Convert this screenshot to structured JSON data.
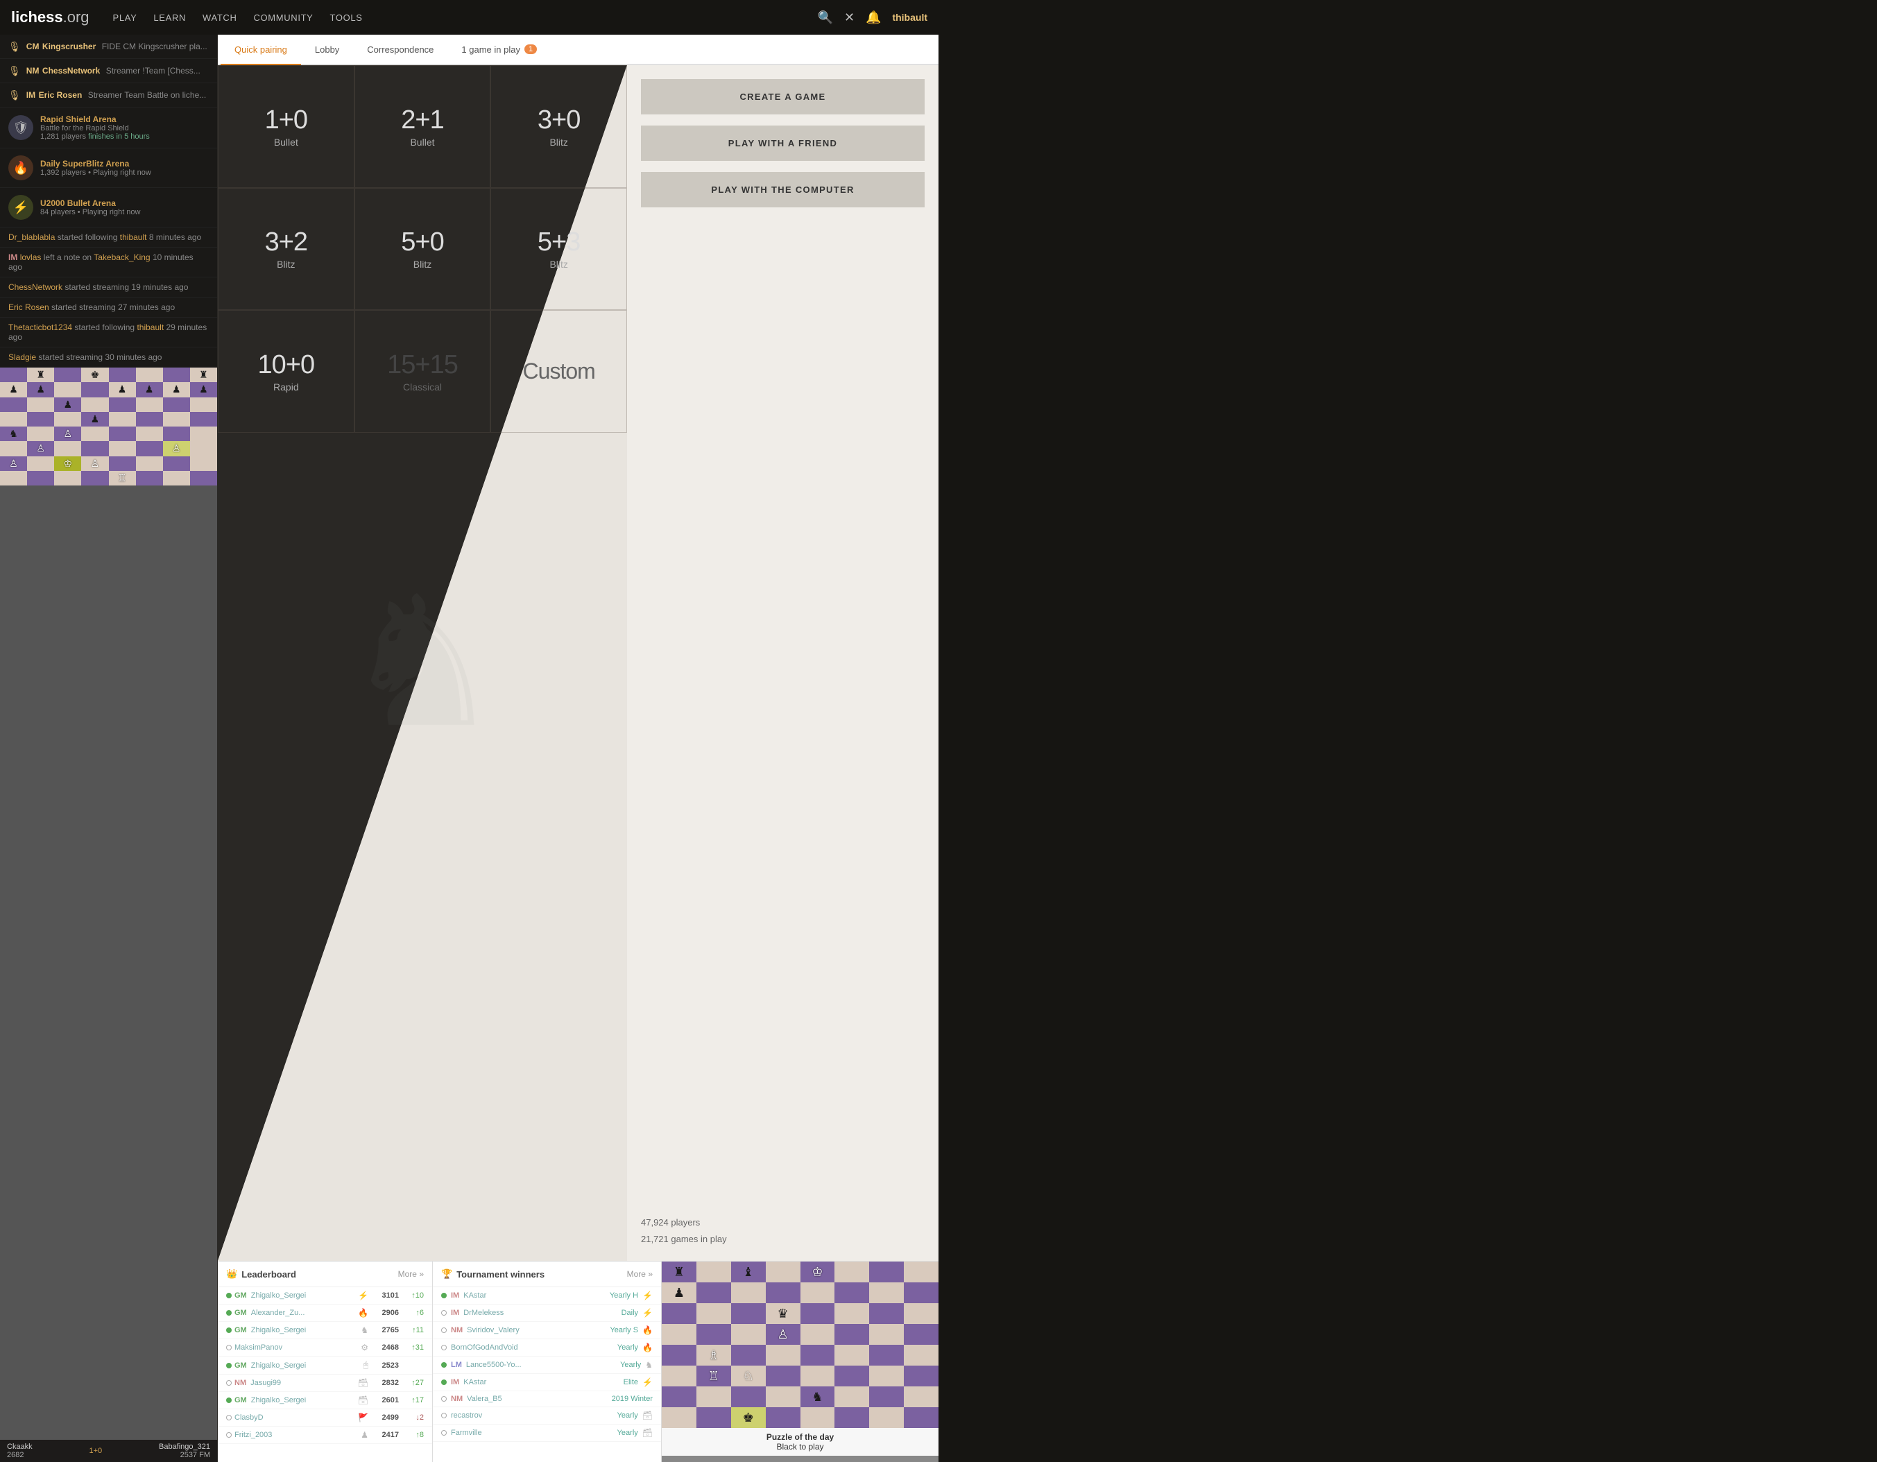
{
  "nav": {
    "logo": "lichess",
    "logo_ext": ".org",
    "links": [
      "PLAY",
      "LEARN",
      "WATCH",
      "COMMUNITY",
      "TOOLS"
    ],
    "user": "thibault"
  },
  "sidebar": {
    "streamers": [
      {
        "title": "CM",
        "name": "Kingscrusher",
        "desc": "FIDE CM Kingscrusher pla..."
      },
      {
        "title": "NM",
        "name": "ChessNetwork",
        "desc": "Streamer !Team [Chess..."
      },
      {
        "title": "IM",
        "name": "Eric Rosen",
        "desc": "Streamer Team Battle on liche..."
      }
    ],
    "tournaments": [
      {
        "icon": "🛡",
        "name": "Rapid Shield Arena",
        "sub": "Battle for the Rapid Shield",
        "players": "1,281 players",
        "time": "finishes in 5 hours"
      },
      {
        "icon": "🔥",
        "name": "Daily SuperBlitz Arena",
        "sub": "1,392 players • Playing right now",
        "players": "",
        "time": ""
      },
      {
        "icon": "⚡",
        "name": "U2000 Bullet Arena",
        "sub": "84 players • Playing right now",
        "players": "",
        "time": ""
      }
    ],
    "activity": [
      {
        "text": "Dr_blablabla started following thibault 8 minutes ago"
      },
      {
        "text": "IM lovlas left a note on Takeback_King 10 minutes ago"
      },
      {
        "text": "ChessNetwork started streaming 19 minutes ago"
      },
      {
        "text": "Eric Rosen started streaming 27 minutes ago"
      },
      {
        "text": "Thetacticbot1234 started following thibault 29 minutes ago"
      },
      {
        "text": "Sladgie started streaming 30 minutes ago"
      }
    ],
    "mini_board": {
      "white_name": "Ckaakk",
      "white_rating": "2682",
      "white_time": "1+0",
      "black_name": "Babafingo_321",
      "black_rating": "2537 FM"
    }
  },
  "tabs": {
    "items": [
      "Quick pairing",
      "Lobby",
      "Correspondence",
      "1 game in play"
    ],
    "active": 0,
    "badge": "1"
  },
  "pairing": {
    "cells": [
      {
        "time": "1+0",
        "type": "Bullet"
      },
      {
        "time": "2+1",
        "type": "Bullet"
      },
      {
        "time": "3+0",
        "type": "Blitz"
      },
      {
        "time": "3+2",
        "type": "Blitz"
      },
      {
        "time": "5+0",
        "type": "Blitz"
      },
      {
        "time": "5+3",
        "type": "Blitz"
      },
      {
        "time": "10+0",
        "type": "Rapid"
      },
      {
        "time": "15+15",
        "type": "Classical"
      },
      {
        "time": "Custom",
        "type": ""
      }
    ]
  },
  "actions": {
    "create": "CREATE A GAME",
    "friend": "PLAY WITH A FRIEND",
    "computer": "PLAY WITH THE COMPUTER",
    "players": "47,924 players",
    "games": "21,721 games in play"
  },
  "leaderboard": {
    "title": "Leaderboard",
    "more": "More »",
    "rows": [
      {
        "online": true,
        "title": "GM",
        "name": "Zhigalko_Sergei",
        "icon": "⚡",
        "rating": "3101",
        "gain": "↑10",
        "gain_neg": false
      },
      {
        "online": true,
        "title": "GM",
        "name": "Alexander_Zu...",
        "icon": "🔥",
        "rating": "2906",
        "gain": "↑6",
        "gain_neg": false
      },
      {
        "online": true,
        "title": "GM",
        "name": "Zhigalko_Sergei",
        "icon": "♞",
        "rating": "2765",
        "gain": "↑11",
        "gain_neg": false
      },
      {
        "online": false,
        "title": "",
        "name": "MaksimPanov",
        "icon": "⚙",
        "rating": "2468",
        "gain": "↑31",
        "gain_neg": false
      },
      {
        "online": true,
        "title": "GM",
        "name": "Zhigalko_Sergei",
        "icon": "🖱",
        "rating": "2523",
        "gain": "",
        "gain_neg": false
      },
      {
        "online": false,
        "title": "NM",
        "name": "Jasugi99",
        "icon": "🗃",
        "rating": "2832",
        "gain": "↑27",
        "gain_neg": false
      },
      {
        "online": true,
        "title": "GM",
        "name": "Zhigalko_Sergei",
        "icon": "🗃",
        "rating": "2601",
        "gain": "↑17",
        "gain_neg": false
      },
      {
        "online": false,
        "title": "",
        "name": "ClasbyD",
        "icon": "🚩",
        "rating": "2499",
        "gain": "↓2",
        "gain_neg": true
      },
      {
        "online": false,
        "title": "",
        "name": "Fritzi_2003",
        "icon": "♟",
        "rating": "2417",
        "gain": "↑8",
        "gain_neg": false
      }
    ]
  },
  "tournament_winners": {
    "title": "Tournament winners",
    "more": "More »",
    "rows": [
      {
        "online": true,
        "title": "IM",
        "name": "KAstar",
        "type": "Yearly H",
        "badge": "⚡"
      },
      {
        "online": false,
        "title": "IM",
        "name": "DrMelekess",
        "type": "Daily",
        "badge": "⚡"
      },
      {
        "online": false,
        "title": "NM",
        "name": "Sviridov_Valery",
        "type": "Yearly S",
        "badge": "🔥"
      },
      {
        "online": false,
        "title": "",
        "name": "BornOfGodAndVoid",
        "type": "Yearly",
        "badge": "🔥"
      },
      {
        "online": true,
        "title": "LM",
        "name": "Lance5500-Yo...",
        "type": "Yearly",
        "badge": "♞"
      },
      {
        "online": true,
        "title": "IM",
        "name": "KAstar",
        "type": "Elite",
        "badge": "⚡"
      },
      {
        "online": false,
        "title": "NM",
        "name": "Valera_B5",
        "type": "2019 Winter",
        "badge": "○"
      },
      {
        "online": false,
        "title": "",
        "name": "recastrov",
        "type": "Yearly",
        "badge": "🗃"
      },
      {
        "online": false,
        "title": "",
        "name": "Farmville",
        "type": "Yearly",
        "badge": "🗃"
      }
    ]
  },
  "puzzle": {
    "title": "Puzzle of the day",
    "subtitle": "Black to play"
  },
  "yearly_labels": [
    "Yearly",
    "Yearly"
  ]
}
